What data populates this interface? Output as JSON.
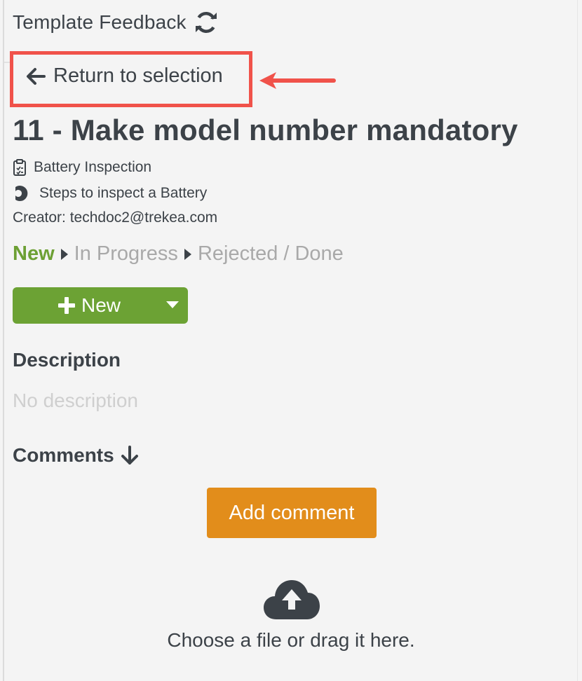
{
  "header": {
    "title": "Template Feedback",
    "refresh_icon": "refresh-icon"
  },
  "nav": {
    "return_label": "Return to selection",
    "return_icon": "arrow-left-icon"
  },
  "annotation": {
    "box_color": "#f0524a",
    "arrow_color": "#f0524a"
  },
  "feedback": {
    "title": "11 - Make model number mandatory",
    "template_name": "Battery Inspection",
    "step_name": "Steps to inspect a Battery",
    "creator": "Creator: techdoc2@trekea.com"
  },
  "status": {
    "current": "New",
    "next": "In Progress",
    "rejected": "Rejected",
    "separator": "/",
    "done": "Done",
    "current_color": "#6da034"
  },
  "status_button": {
    "label": "New",
    "color": "#6ca234"
  },
  "description": {
    "heading": "Description",
    "empty_text": "No description"
  },
  "comments": {
    "heading": "Comments",
    "add_label": "Add comment",
    "add_color": "#e28d1b"
  },
  "upload": {
    "text": "Choose a file or drag it here.",
    "icon": "cloud-upload-icon"
  }
}
